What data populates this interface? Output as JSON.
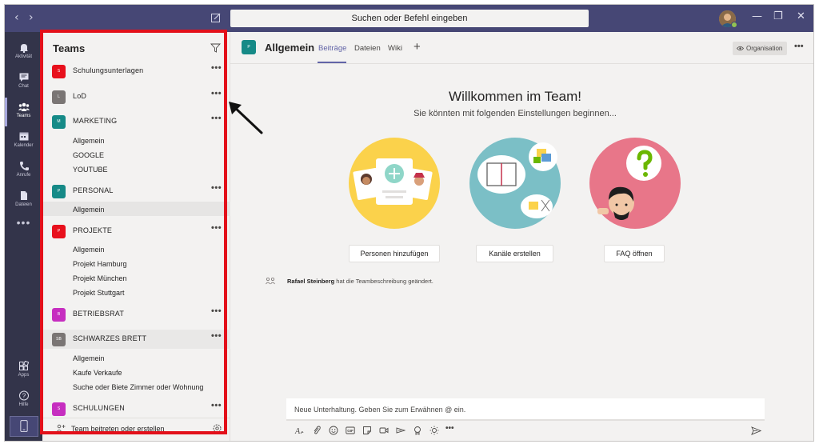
{
  "topbar": {
    "search_placeholder": "Suchen oder Befehl eingeben",
    "back_icon": "chevron-left-icon",
    "forward_icon": "chevron-right-icon",
    "minimize": "—",
    "maximize": "❐",
    "close": "✕"
  },
  "rail": {
    "items": [
      {
        "label": "Aktivität",
        "icon": "bell-icon"
      },
      {
        "label": "Chat",
        "icon": "chat-icon"
      },
      {
        "label": "Teams",
        "icon": "teams-icon"
      },
      {
        "label": "Kalender",
        "icon": "calendar-icon"
      },
      {
        "label": "Anrufe",
        "icon": "phone-icon"
      },
      {
        "label": "Dateien",
        "icon": "files-icon"
      }
    ],
    "more": "•••",
    "apps_label": "Apps",
    "help_label": "Hilfe"
  },
  "teams_panel": {
    "title": "Teams",
    "teams": [
      {
        "initial": "S",
        "name": "Schulungsunterlagen",
        "color": "#e8101c"
      },
      {
        "initial": "L",
        "name": "LoD",
        "color": "#7a7574"
      },
      {
        "initial": "M",
        "name": "MARKETING",
        "color": "#168a87",
        "channels": [
          "Allgemein",
          "GOOGLE",
          "YOUTUBE"
        ]
      },
      {
        "initial": "P",
        "name": "PERSONAL",
        "color": "#168a87",
        "channels": [
          "Allgemein"
        ]
      },
      {
        "initial": "P",
        "name": "PROJEKTE",
        "color": "#e8101c",
        "channels": [
          "Allgemein",
          "Projekt Hamburg",
          "Projekt München",
          "Projekt Stuttgart"
        ]
      },
      {
        "initial": "B",
        "name": "BETRIEBSRAT",
        "color": "#c62ec0"
      },
      {
        "initial": "SB",
        "name": "SCHWARZES BRETT",
        "color": "#7a7574",
        "channels": [
          "Allgemein",
          "Kaufe Verkaufe",
          "Suche oder Biete Zimmer oder Wohnung"
        ]
      },
      {
        "initial": "S",
        "name": "SCHULUNGEN",
        "color": "#c62ec0"
      }
    ],
    "more_label": "•••",
    "join_label": "Team beitreten oder erstellen"
  },
  "main": {
    "channel_initial": "P",
    "channel_title": "Allgemein",
    "tabs": [
      "Beiträge",
      "Dateien",
      "Wiki"
    ],
    "tab_add": "+",
    "org_label": "Organisation",
    "header_more": "•••",
    "welcome_title": "Willkommen im Team!",
    "welcome_sub": "Sie könnten mit folgenden Einstellungen beginnen...",
    "actions": [
      "Personen hinzufügen",
      "Kanäle erstellen",
      "FAQ öffnen"
    ],
    "activity_user": "Rafael Steinberg",
    "activity_text": " hat die Teambeschreibung geändert.",
    "compose_placeholder": "Neue Unterhaltung. Geben Sie zum Erwähnen @ ein.",
    "format_more": "•••"
  },
  "colors": {
    "brand": "#464775",
    "rail": "#33344a",
    "accent": "#6264a7",
    "highlight_outline": "#e3101a"
  }
}
